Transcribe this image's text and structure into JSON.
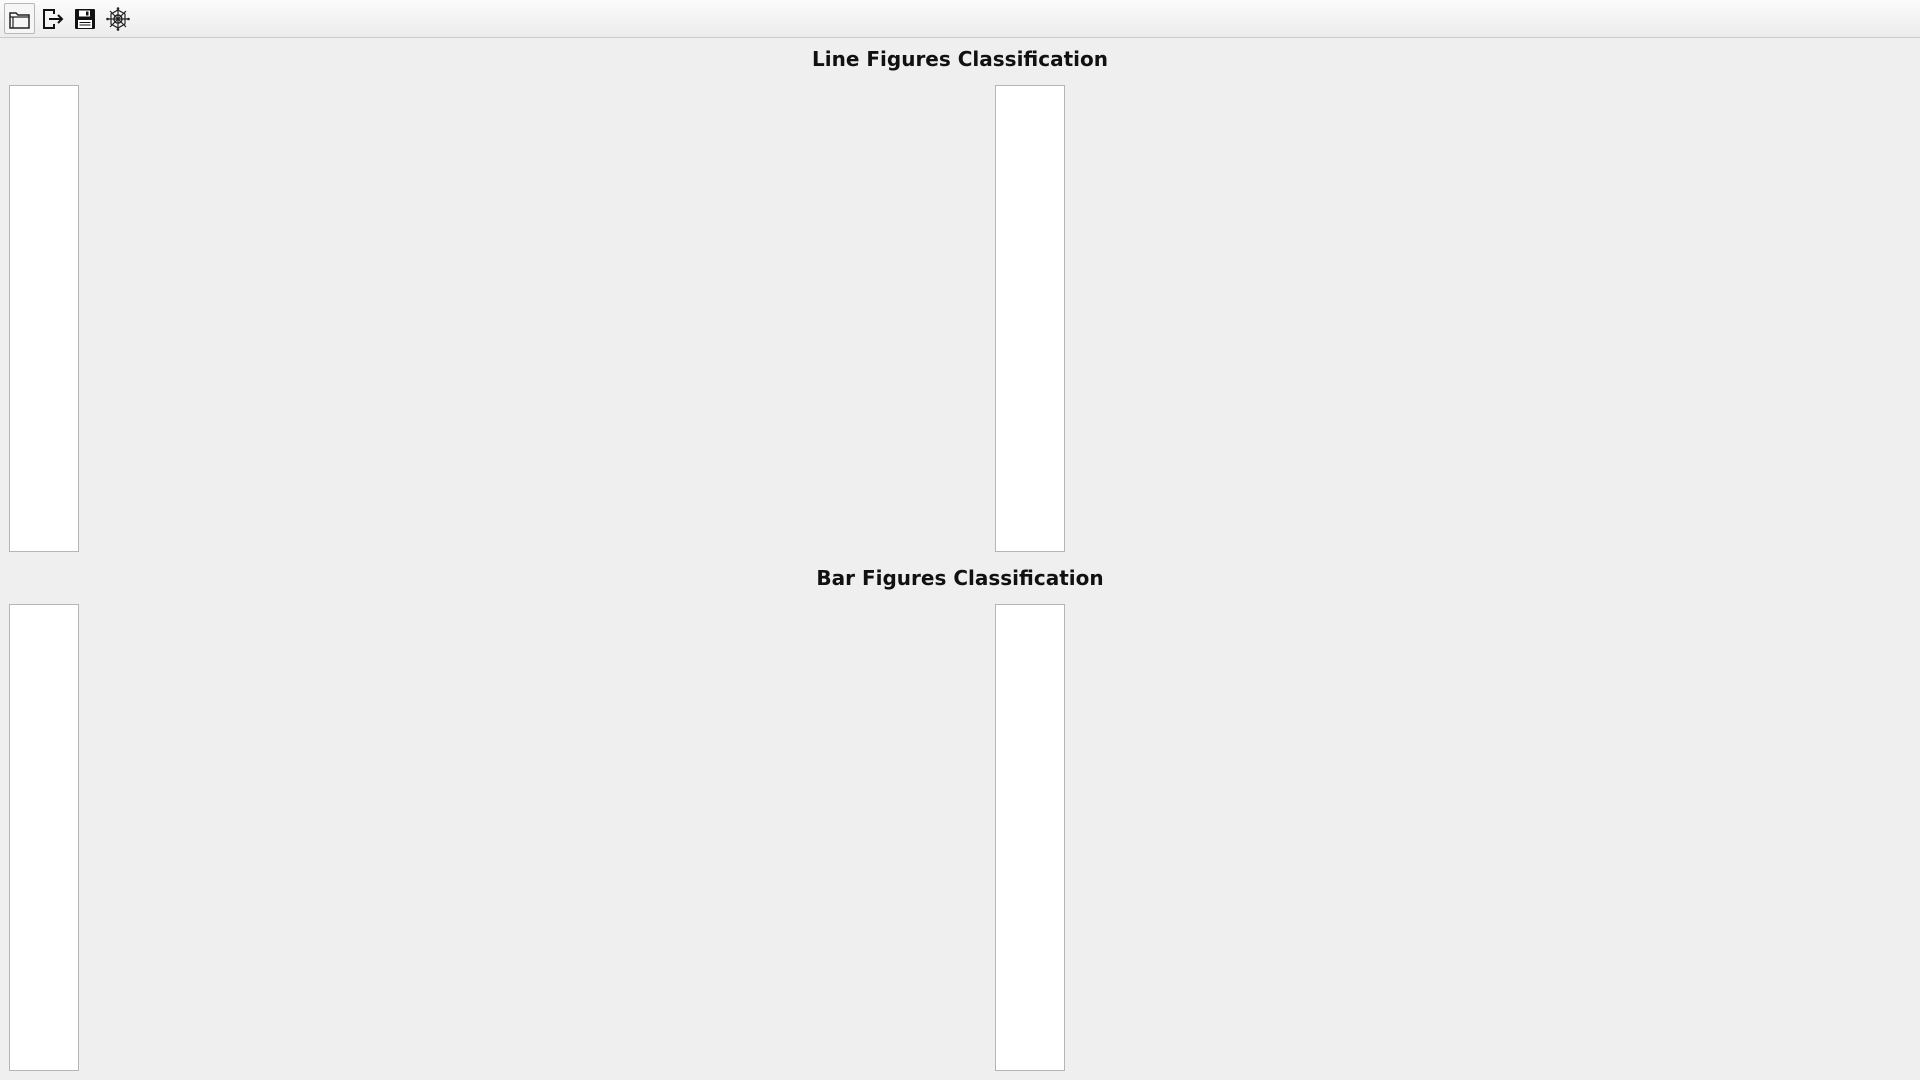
{
  "toolbar": {
    "buttons": [
      {
        "icon": "folder-open-icon",
        "label": "Open"
      },
      {
        "icon": "export-icon",
        "label": "Export"
      },
      {
        "icon": "save-icon",
        "label": "Save"
      },
      {
        "icon": "settings-icon",
        "label": "Settings"
      }
    ]
  },
  "sections": [
    {
      "title": "Line Figures Classification"
    },
    {
      "title": "Bar Figures Classification"
    }
  ]
}
